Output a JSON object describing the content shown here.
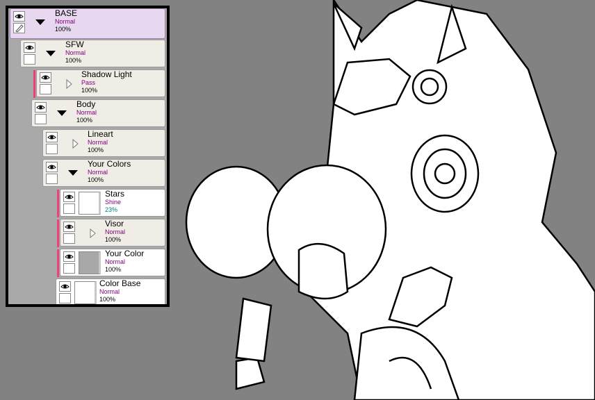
{
  "layers": [
    {
      "name": "BASE",
      "mode": "Normal",
      "opacity": "100%",
      "group": "expanded",
      "selected": true
    },
    {
      "name": "SFW",
      "mode": "Normal",
      "opacity": "100%",
      "group": "expanded"
    },
    {
      "name": "Shadow Light",
      "mode": "Pass",
      "opacity": "100%",
      "group": "collapsed",
      "clipped": true
    },
    {
      "name": "Body",
      "mode": "Normal",
      "opacity": "100%",
      "group": "expanded"
    },
    {
      "name": "Lineart",
      "mode": "Normal",
      "opacity": "100%",
      "group": "collapsed"
    },
    {
      "name": "Your Colors",
      "mode": "Normal",
      "opacity": "100%",
      "group": "expanded"
    },
    {
      "name": "Stars",
      "mode": "Shine",
      "opacity": "23%",
      "clipped": true
    },
    {
      "name": "Visor",
      "mode": "Normal",
      "opacity": "100%",
      "group": "collapsed",
      "clipped": true
    },
    {
      "name": "Your Color",
      "mode": "Normal",
      "opacity": "100%",
      "clipped": true
    },
    {
      "name": "Color Base",
      "mode": "Normal",
      "opacity": "100%"
    }
  ],
  "colors": {
    "clip_bar": "#f0407a",
    "mode_text": "#800080",
    "opacity_low": "#008080"
  }
}
